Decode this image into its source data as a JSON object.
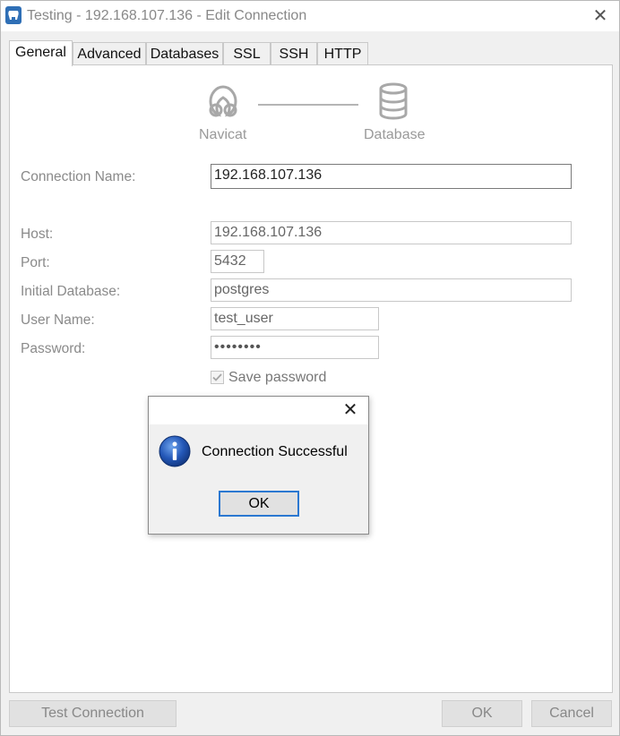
{
  "window": {
    "title": "Testing - 192.168.107.136 - Edit Connection",
    "app_icon": "postgresql-elephant-icon",
    "close_icon": "close-icon"
  },
  "tabs": [
    {
      "label": "General",
      "active": true
    },
    {
      "label": "Advanced",
      "active": false
    },
    {
      "label": "Databases",
      "active": false
    },
    {
      "label": "SSL",
      "active": false
    },
    {
      "label": "SSH",
      "active": false
    },
    {
      "label": "HTTP",
      "active": false
    }
  ],
  "diagram": {
    "left_label": "Navicat",
    "left_icon": "navicat-icon",
    "right_label": "Database",
    "right_icon": "database-icon"
  },
  "form": {
    "connection_name_label": "Connection Name:",
    "connection_name_value": "192.168.107.136",
    "host_label": "Host:",
    "host_value": "192.168.107.136",
    "port_label": "Port:",
    "port_value": "5432",
    "initial_db_label": "Initial Database:",
    "initial_db_value": "postgres",
    "user_label": "User Name:",
    "user_value": "test_user",
    "password_label": "Password:",
    "password_masked": "••••••••",
    "save_password_label": "Save password",
    "save_password_checked": true
  },
  "buttons": {
    "test_connection": "Test Connection",
    "ok": "OK",
    "cancel": "Cancel"
  },
  "message_box": {
    "text": "Connection Successful",
    "ok_label": "OK",
    "icon": "info-icon",
    "close_icon": "close-icon"
  },
  "colors": {
    "focus_border": "#2b78d1",
    "info_icon_blue": "#1f4fa8",
    "app_icon_blue": "#2f6fb6"
  }
}
